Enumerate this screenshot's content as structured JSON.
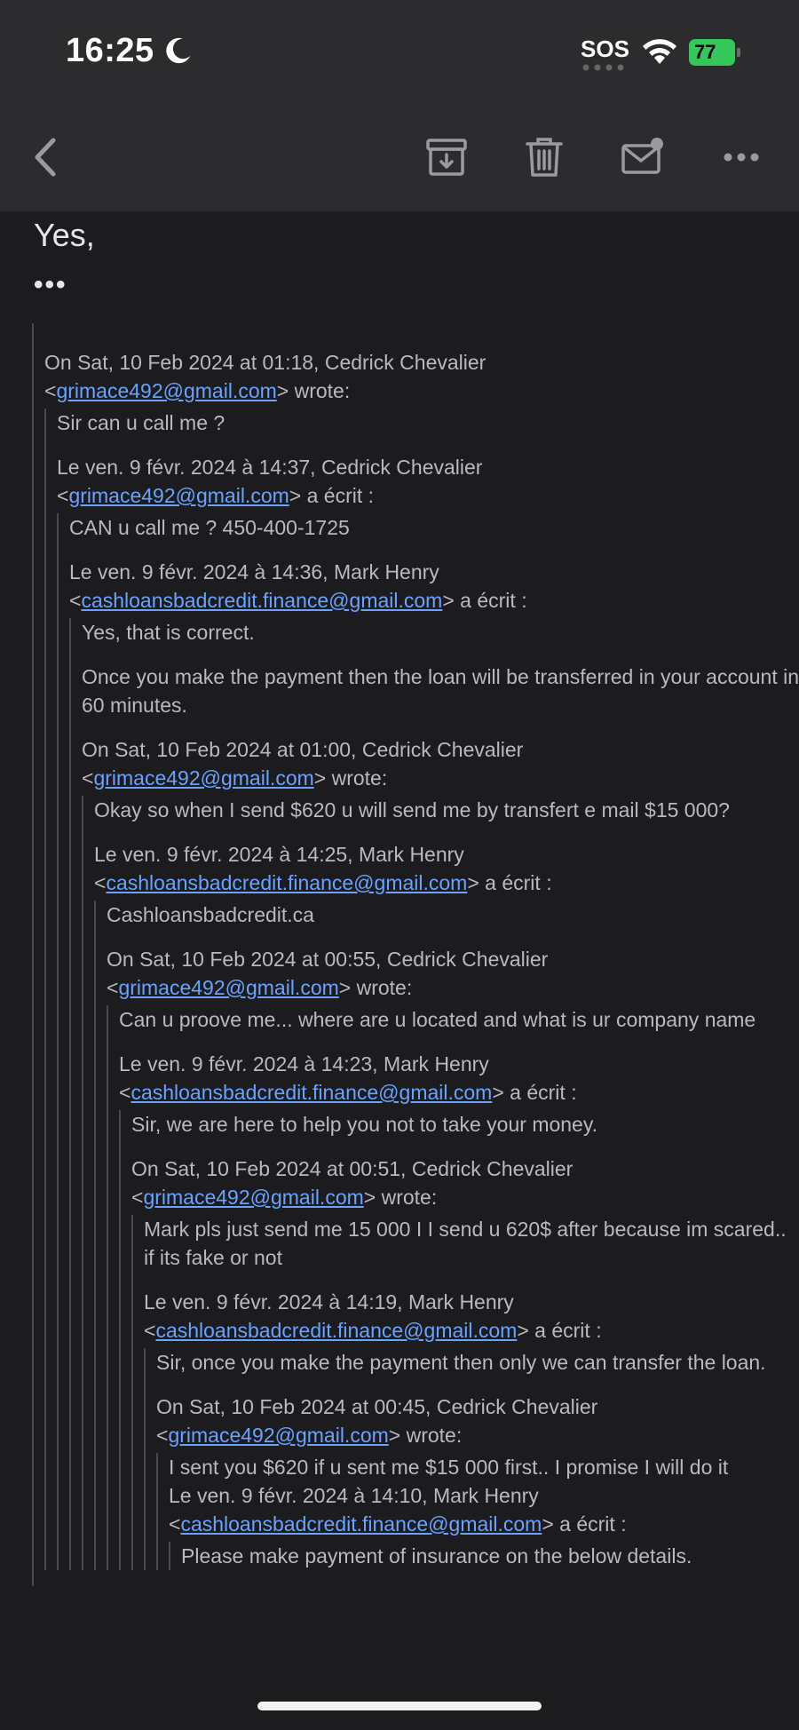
{
  "status": {
    "time": "16:25",
    "sos": "SOS",
    "battery": "77"
  },
  "toolbar": {
    "back_icon": "chevron-left-icon",
    "archive_icon": "archive-box-icon",
    "trash_icon": "trash-icon",
    "mark_unread_icon": "envelope-badge-icon",
    "more_icon": "more-icon"
  },
  "email": {
    "greeting": "Yes,",
    "ellipsis": "•••",
    "thread": [
      {
        "attr_pre": "On Sat, 10 Feb 2024 at 01:18, Cedrick Chevalier",
        "email": "grimace492@gmail.com",
        "attr_post": " wrote:",
        "body": [
          "Sir can u call me ?"
        ]
      },
      {
        "attr_pre": "Le ven. 9 févr. 2024 à 14:37, Cedrick Chevalier",
        "email": "grimace492@gmail.com",
        "attr_post": " a écrit :",
        "body": [
          "CAN u call me ? 450-400-1725"
        ]
      },
      {
        "attr_pre": "Le ven. 9 févr. 2024 à 14:36, Mark Henry",
        "email": "cashloansbadcredit.finance@gmail.com",
        "attr_post": " a écrit :",
        "body": [
          "Yes, that is correct.",
          "Once you make the payment then the loan will be transferred in your account in 60 minutes."
        ]
      },
      {
        "attr_pre": "On Sat, 10 Feb 2024 at 01:00, Cedrick Chevalier",
        "email": "grimace492@gmail.com",
        "attr_post": " wrote:",
        "body": [
          "Okay so when I send $620 u will send me by transfert e mail $15 000?"
        ]
      },
      {
        "attr_pre": "Le ven. 9 févr. 2024 à 14:25, Mark Henry",
        "email": "cashloansbadcredit.finance@gmail.com",
        "attr_post": " a écrit :",
        "body": [
          "Cashloansbadcredit.ca"
        ]
      },
      {
        "attr_pre": "On Sat, 10 Feb 2024 at 00:55, Cedrick Chevalier",
        "email": "grimace492@gmail.com",
        "attr_post": " wrote:",
        "body": [
          "Can u proove me... where are u located and what is ur company name"
        ]
      },
      {
        "attr_pre": "Le ven. 9 févr. 2024 à 14:23, Mark Henry",
        "email": "cashloansbadcredit.finance@gmail.com",
        "attr_post": " a écrit :",
        "body": [
          "Sir, we are here to  help you not to take your money."
        ]
      },
      {
        "attr_pre": "On Sat, 10 Feb 2024 at 00:51, Cedrick Chevalier",
        "email": "grimace492@gmail.com",
        "attr_post": " wrote:",
        "body": [
          "Mark pls just send me 15 000 I I send u 620$ after because im scared.. if its fake or not"
        ]
      },
      {
        "attr_pre": "Le ven. 9 févr. 2024 à 14:19, Mark Henry",
        "email": "cashloansbadcredit.finance@gmail.com",
        "attr_post": " a écrit :",
        "body": [
          "Sir, once you make the payment then only we can transfer the loan."
        ]
      },
      {
        "attr_pre": "On Sat, 10 Feb 2024 at 00:45, Cedrick Chevalier",
        "email": "grimace492@gmail.com",
        "attr_post": " wrote:",
        "body": [
          "I sent you $620 if u sent me $15 000 first.. I promise I will do it"
        ]
      },
      {
        "attr_pre": "Le ven. 9 févr. 2024 à 14:10, Mark Henry",
        "email": "cashloansbadcredit.finance@gmail.com",
        "attr_post": " a écrit :",
        "body": [
          "Please make payment of insurance on the below details."
        ]
      }
    ]
  }
}
